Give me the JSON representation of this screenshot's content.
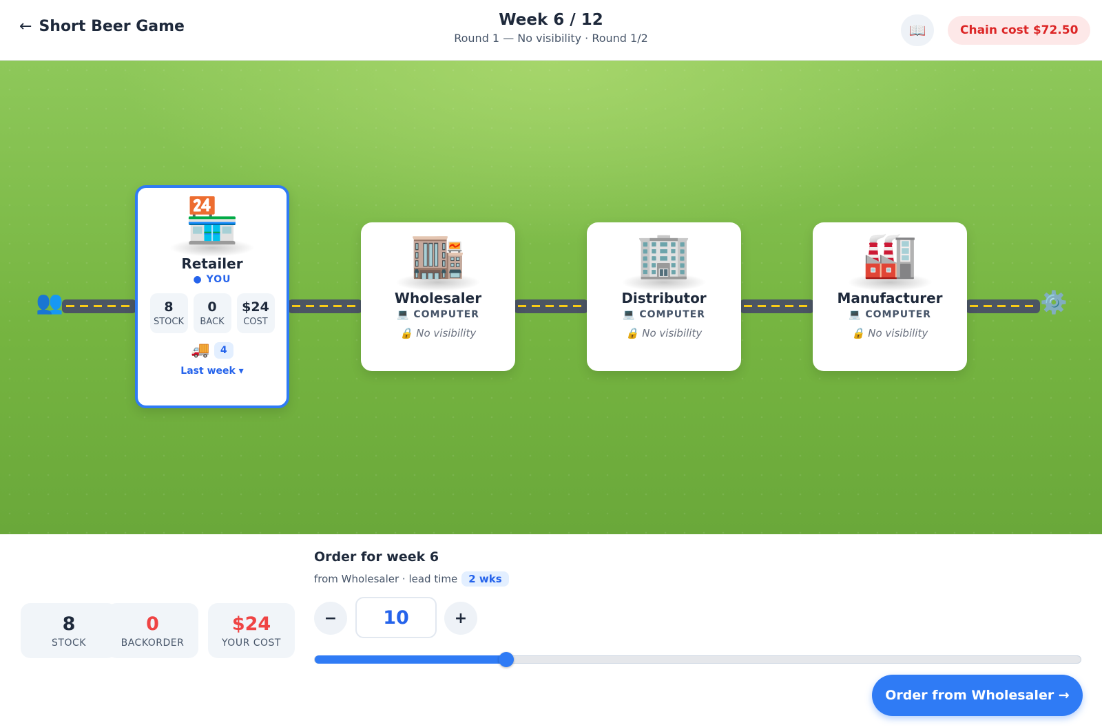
{
  "header": {
    "title": "Short Beer Game",
    "week": "Week 6 / 12",
    "round": "Round 1 — No visibility · Round 1/2",
    "chain_cost": "Chain cost $72.50"
  },
  "icons": {
    "back": "←",
    "book": "📖",
    "customers": "👥",
    "gear": "⚙️",
    "retailer": "🏪",
    "wholesaler": "🏬",
    "distributor": "🏢",
    "manufacturer": "🏭",
    "computer": "💻",
    "lock": "🔒",
    "truck": "🚚"
  },
  "retailer": {
    "name": "Retailer",
    "you": "YOU",
    "stock_value": "8",
    "stock_label": "STOCK",
    "back_value": "0",
    "back_label": "BACK",
    "cost_value": "$24",
    "cost_label": "COST",
    "incoming": "4",
    "last_week": "Last week ▾"
  },
  "wholesaler": {
    "name": "Wholesaler",
    "role": "COMPUTER",
    "visibility": "No visibility"
  },
  "distributor": {
    "name": "Distributor",
    "role": "COMPUTER",
    "visibility": "No visibility"
  },
  "manufacturer": {
    "name": "Manufacturer",
    "role": "COMPUTER",
    "visibility": "No visibility"
  },
  "panel": {
    "stock_value": "8",
    "stock_label": "STOCK",
    "backorder_value": "0",
    "backorder_label": "BACKORDER",
    "cost_value": "$24",
    "cost_label": "YOUR COST",
    "order_title": "Order for week 6",
    "order_sub": "from Wholesaler · lead time",
    "lead_time": "2 wks",
    "minus": "−",
    "plus": "+",
    "quantity": "10",
    "slider_fraction": 0.25,
    "order_button": "Order from Wholesaler →"
  },
  "colors": {
    "accent": "#2f7bf5",
    "danger": "#ef4444",
    "field": "#7ab846"
  }
}
